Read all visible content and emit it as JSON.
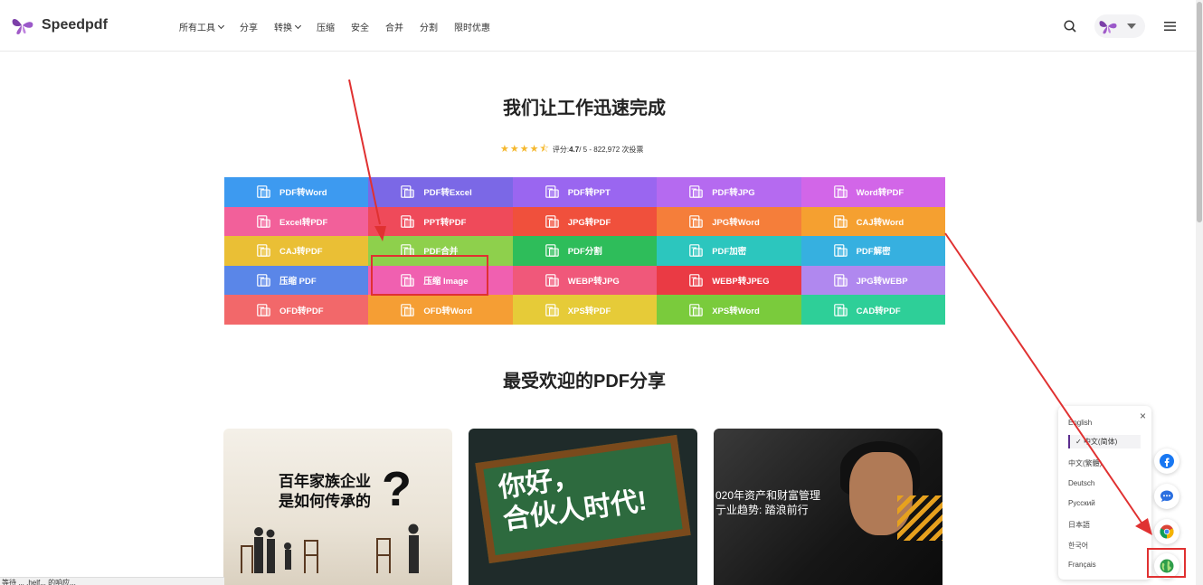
{
  "header": {
    "logo_text": "Speedpdf",
    "nav": [
      {
        "label": "所有工具",
        "has_dropdown": true
      },
      {
        "label": "分享",
        "has_dropdown": false
      },
      {
        "label": "转换",
        "has_dropdown": true
      },
      {
        "label": "压缩",
        "has_dropdown": false
      },
      {
        "label": "安全",
        "has_dropdown": false
      },
      {
        "label": "合并",
        "has_dropdown": false
      },
      {
        "label": "分割",
        "has_dropdown": false
      },
      {
        "label": "限时优惠",
        "has_dropdown": false
      }
    ]
  },
  "hero": {
    "title": "我们让工作迅速完成",
    "rating_prefix": "评分: ",
    "rating_value": "4.7",
    "rating_suffix": " / 5 - 822,972 次投票",
    "stars": 4.5
  },
  "tools": [
    {
      "label": "PDF转Word",
      "color": "#3d9af0"
    },
    {
      "label": "PDF转Excel",
      "color": "#7b68e6"
    },
    {
      "label": "PDF转PPT",
      "color": "#9a66f0"
    },
    {
      "label": "PDF转JPG",
      "color": "#b56af0"
    },
    {
      "label": "Word转PDF",
      "color": "#d266e8"
    },
    {
      "label": "Excel转PDF",
      "color": "#f2609a"
    },
    {
      "label": "PPT转PDF",
      "color": "#ef4a5a"
    },
    {
      "label": "JPG转PDF",
      "color": "#f0503c"
    },
    {
      "label": "JPG转Word",
      "color": "#f57e3a"
    },
    {
      "label": "CAJ转Word",
      "color": "#f5a030"
    },
    {
      "label": "CAJ转PDF",
      "color": "#eabf35"
    },
    {
      "label": "PDF合并",
      "color": "#8ed04c"
    },
    {
      "label": "PDF分割",
      "color": "#2ebd5a"
    },
    {
      "label": "PDF加密",
      "color": "#2cc6be"
    },
    {
      "label": "PDF解密",
      "color": "#36b0e0"
    },
    {
      "label": "压缩 PDF",
      "color": "#5a86e8"
    },
    {
      "label": "压缩 Image",
      "color": "#f060b0"
    },
    {
      "label": "WEBP转JPG",
      "color": "#f0587a"
    },
    {
      "label": "WEBP转JPEG",
      "color": "#ea3a44"
    },
    {
      "label": "JPG转WEBP",
      "color": "#b088ef"
    },
    {
      "label": "OFD转PDF",
      "color": "#f2686a"
    },
    {
      "label": "OFD转Word",
      "color": "#f59e34"
    },
    {
      "label": "XPS转PDF",
      "color": "#e6cb38"
    },
    {
      "label": "XPS转Word",
      "color": "#7acb3c"
    },
    {
      "label": "CAD转PDF",
      "color": "#2ecf98"
    }
  ],
  "section": {
    "title": "最受欢迎的PDF分享"
  },
  "cards": {
    "card1_line1": "百年家族企业",
    "card1_line2": "是如何传承的",
    "card1_mark": "?",
    "card2_line1": "你好，",
    "card2_line2": "合伙人时代!",
    "card3_line1": "020年资产和财富管理",
    "card3_line2": "亍业趋势: 踏浪前行"
  },
  "languages": {
    "items": [
      "English",
      "中文(简体)",
      "中文(繁體)",
      "Deutsch",
      "Русский",
      "日本語",
      "한국어",
      "Français"
    ],
    "active_index": 1,
    "close": "×"
  },
  "status_text": "等待 ... .helf... 的响应..."
}
